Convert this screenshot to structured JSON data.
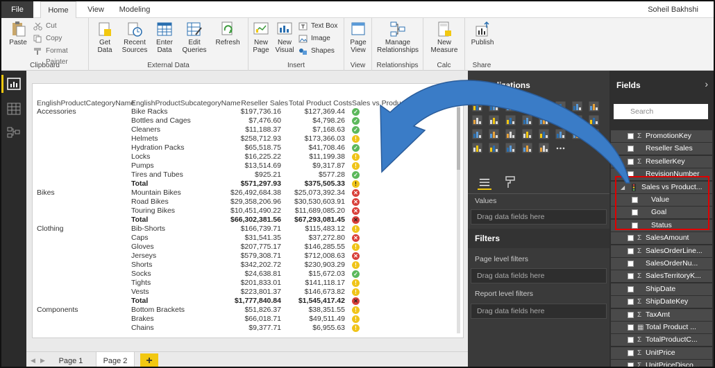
{
  "tabs": {
    "file": "File",
    "home": "Home",
    "view": "View",
    "modeling": "Modeling"
  },
  "user": "Soheil Bakhshi",
  "ribbon": {
    "clipboard": {
      "label": "Clipboard",
      "paste": "Paste",
      "cut": "Cut",
      "copy": "Copy",
      "format_painter": "Format Painter"
    },
    "external": {
      "label": "External Data",
      "get_data": "Get\nData",
      "recent_sources": "Recent\nSources",
      "enter_data": "Enter\nData",
      "edit_queries": "Edit\nQueries",
      "refresh": "Refresh"
    },
    "insert": {
      "label": "Insert",
      "new_page": "New\nPage",
      "new_visual": "New\nVisual",
      "text_box": "Text Box",
      "image": "Image",
      "shapes": "Shapes"
    },
    "view": {
      "label": "View",
      "page_view": "Page\nView"
    },
    "relationships": {
      "label": "Relationships",
      "manage": "Manage\nRelationships"
    },
    "calc": {
      "label": "Calc",
      "new_measure": "New\nMeasure"
    },
    "share": {
      "label": "Share",
      "publish": "Publish"
    }
  },
  "table": {
    "headers": [
      "EnglishProductCategoryName",
      "EnglishProductSubcategoryName",
      "Reseller Sales",
      "Total Product Costs",
      "Sales vs Product Costs Status"
    ],
    "rows": [
      {
        "cat": "Accessories",
        "sub": "Bike Racks",
        "sales": "$197,736.16",
        "cost": "$127,369.44",
        "status": "green",
        "total": false
      },
      {
        "cat": "",
        "sub": "Bottles and Cages",
        "sales": "$7,476.60",
        "cost": "$4,798.26",
        "status": "green",
        "total": false
      },
      {
        "cat": "",
        "sub": "Cleaners",
        "sales": "$11,188.37",
        "cost": "$7,168.63",
        "status": "green",
        "total": false
      },
      {
        "cat": "",
        "sub": "Helmets",
        "sales": "$258,712.93",
        "cost": "$173,366.03",
        "status": "yellow",
        "total": false
      },
      {
        "cat": "",
        "sub": "Hydration Packs",
        "sales": "$65,518.75",
        "cost": "$41,708.46",
        "status": "green",
        "total": false
      },
      {
        "cat": "",
        "sub": "Locks",
        "sales": "$16,225.22",
        "cost": "$11,199.38",
        "status": "yellow",
        "total": false
      },
      {
        "cat": "",
        "sub": "Pumps",
        "sales": "$13,514.69",
        "cost": "$9,317.87",
        "status": "yellow",
        "total": false
      },
      {
        "cat": "",
        "sub": "Tires and Tubes",
        "sales": "$925.21",
        "cost": "$577.28",
        "status": "green",
        "total": false
      },
      {
        "cat": "",
        "sub": "Total",
        "sales": "$571,297.93",
        "cost": "$375,505.33",
        "status": "yellow",
        "total": true
      },
      {
        "cat": "Bikes",
        "sub": "Mountain Bikes",
        "sales": "$26,492,684.38",
        "cost": "$25,073,392.34",
        "status": "red",
        "total": false
      },
      {
        "cat": "",
        "sub": "Road Bikes",
        "sales": "$29,358,206.96",
        "cost": "$30,530,603.91",
        "status": "red",
        "total": false
      },
      {
        "cat": "",
        "sub": "Touring Bikes",
        "sales": "$10,451,490.22",
        "cost": "$11,689,085.20",
        "status": "red",
        "total": false
      },
      {
        "cat": "",
        "sub": "Total",
        "sales": "$66,302,381.56",
        "cost": "$67,293,081.45",
        "status": "red",
        "total": true
      },
      {
        "cat": "Clothing",
        "sub": "Bib-Shorts",
        "sales": "$166,739.71",
        "cost": "$115,483.12",
        "status": "yellow",
        "total": false
      },
      {
        "cat": "",
        "sub": "Caps",
        "sales": "$31,541.35",
        "cost": "$37,272.80",
        "status": "red",
        "total": false
      },
      {
        "cat": "",
        "sub": "Gloves",
        "sales": "$207,775.17",
        "cost": "$146,285.55",
        "status": "yellow",
        "total": false
      },
      {
        "cat": "",
        "sub": "Jerseys",
        "sales": "$579,308.71",
        "cost": "$712,008.63",
        "status": "red",
        "total": false
      },
      {
        "cat": "",
        "sub": "Shorts",
        "sales": "$342,202.72",
        "cost": "$230,903.29",
        "status": "yellow",
        "total": false
      },
      {
        "cat": "",
        "sub": "Socks",
        "sales": "$24,638.81",
        "cost": "$15,672.03",
        "status": "green",
        "total": false
      },
      {
        "cat": "",
        "sub": "Tights",
        "sales": "$201,833.01",
        "cost": "$141,118.17",
        "status": "yellow",
        "total": false
      },
      {
        "cat": "",
        "sub": "Vests",
        "sales": "$223,801.37",
        "cost": "$146,673.82",
        "status": "yellow",
        "total": false
      },
      {
        "cat": "",
        "sub": "Total",
        "sales": "$1,777,840.84",
        "cost": "$1,545,417.42",
        "status": "red",
        "total": true
      },
      {
        "cat": "Components",
        "sub": "Bottom Brackets",
        "sales": "$51,826.37",
        "cost": "$38,351.55",
        "status": "yellow",
        "total": false
      },
      {
        "cat": "",
        "sub": "Brakes",
        "sales": "$66,018.71",
        "cost": "$49,511.49",
        "status": "yellow",
        "total": false
      },
      {
        "cat": "",
        "sub": "Chains",
        "sales": "$9,377.71",
        "cost": "$6,955.63",
        "status": "yellow",
        "total": false
      }
    ]
  },
  "pages": {
    "page1": "Page 1",
    "page2": "Page 2",
    "add": "+"
  },
  "viz": {
    "title": "Visualizations",
    "values_label": "Values",
    "drop_hint": "Drag data fields here",
    "filters_title": "Filters",
    "page_filters": "Page level filters",
    "report_filters": "Report level filters"
  },
  "fields": {
    "title": "Fields",
    "search_placeholder": "Search",
    "items": [
      "PromotionKey",
      "Reseller Sales",
      "ResellerKey",
      "RevisionNumber",
      "Sales vs Product...",
      "Value",
      "Goal",
      "Status",
      "SalesAmount",
      "SalesOrderLine...",
      "SalesOrderNu...",
      "SalesTerritoryK...",
      "ShipDate",
      "ShipDateKey",
      "TaxAmt",
      "Total Product ...",
      "TotalProductC...",
      "UnitPrice",
      "UnitPriceDisco..."
    ]
  },
  "colors": {
    "accent": "#f2c811",
    "status_green": "#5cb85c",
    "status_yellow": "#f0c419",
    "status_red": "#d9403a",
    "highlight": "#e00000",
    "arrow": "#3a7cc7"
  }
}
